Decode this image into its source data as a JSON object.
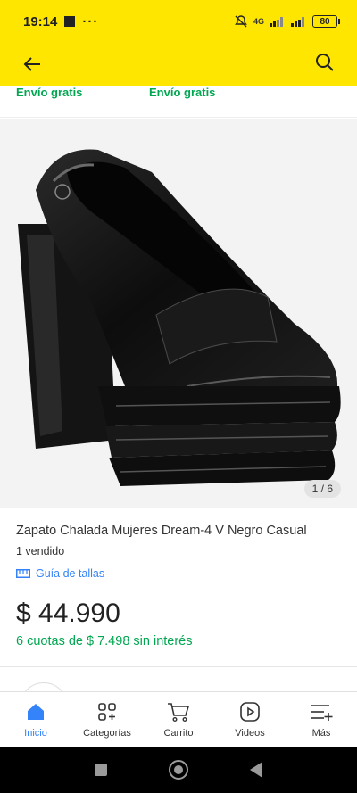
{
  "status": {
    "time": "19:14",
    "dots": "···",
    "network": "4G",
    "battery": "80"
  },
  "shipping": {
    "left": "Envío gratis",
    "right": "Envío gratis"
  },
  "product": {
    "image_counter": "1 / 6",
    "title": "Zapato Chalada Mujeres Dream-4 V Negro Casual",
    "sold": "1 vendido",
    "size_guide": "Guía de tallas",
    "price": "$ 44.990",
    "installments": "6 cuotas de $ 7.498 sin interés",
    "image_progress": 0.1667
  },
  "tabs": [
    {
      "label": "Inicio",
      "icon": "home-icon"
    },
    {
      "label": "Categorías",
      "icon": "categories-icon"
    },
    {
      "label": "Carrito",
      "icon": "cart-icon"
    },
    {
      "label": "Videos",
      "icon": "videos-icon"
    },
    {
      "label": "Más",
      "icon": "more-icon"
    }
  ],
  "colors": {
    "brand_yellow": "#FFE600",
    "accent_blue": "#3483FA",
    "success_green": "#00A650"
  }
}
